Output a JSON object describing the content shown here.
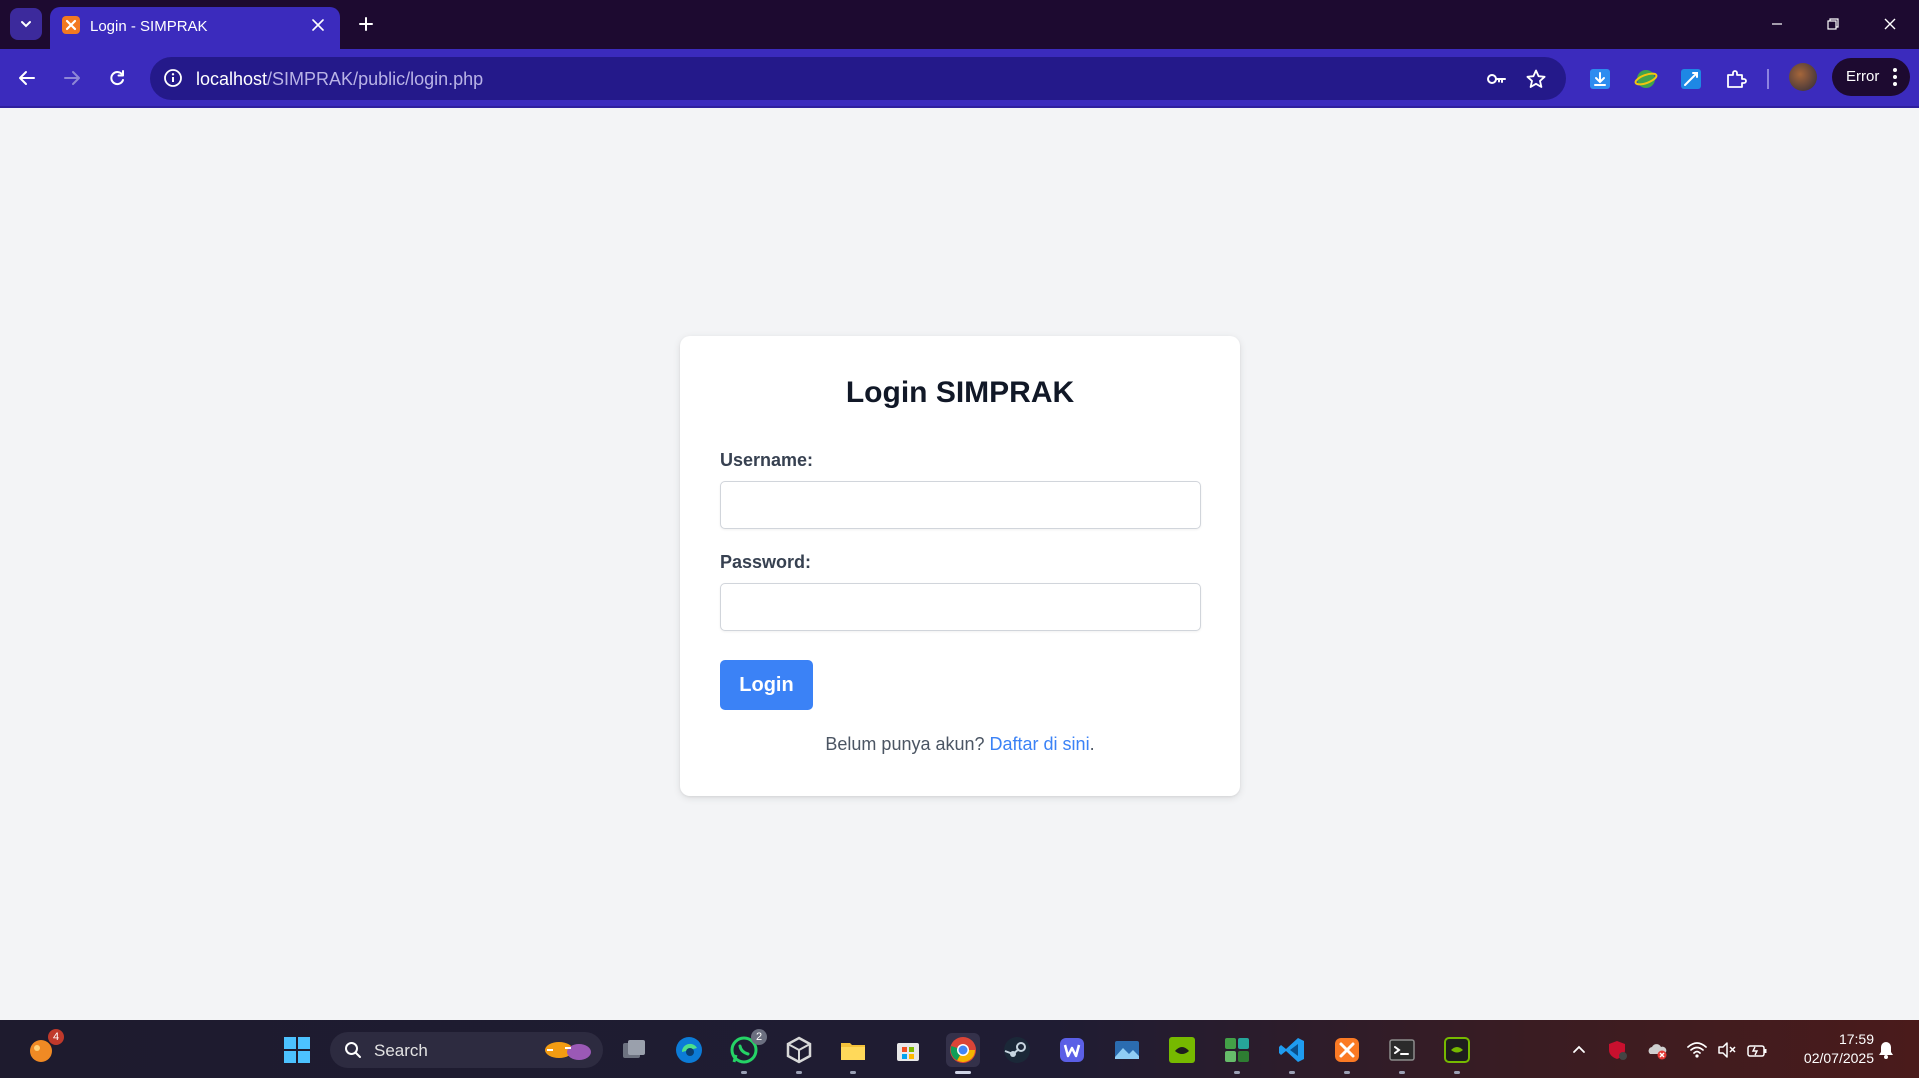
{
  "browser": {
    "tab_title": "Login - SIMPRAK",
    "url_host": "localhost",
    "url_path": "/SIMPRAK/public/login.php",
    "profile_status": "Error"
  },
  "login": {
    "heading": "Login SIMPRAK",
    "username_label": "Username:",
    "username_value": "",
    "password_label": "Password:",
    "password_value": "",
    "submit_label": "Login",
    "register_prompt": "Belum punya akun?",
    "register_link": "Daftar di sini",
    "register_suffix": "."
  },
  "taskbar": {
    "search_placeholder": "Search",
    "widgets_badge": "4",
    "whatsapp_badge": "2",
    "time": "17:59",
    "date": "02/07/2025"
  },
  "colors": {
    "tab_strip": "#1d0a30",
    "toolbar": "#3b2bbd",
    "page_background": "#f3f4f6",
    "primary_button": "#3b82f6",
    "link": "#3b82f6"
  }
}
